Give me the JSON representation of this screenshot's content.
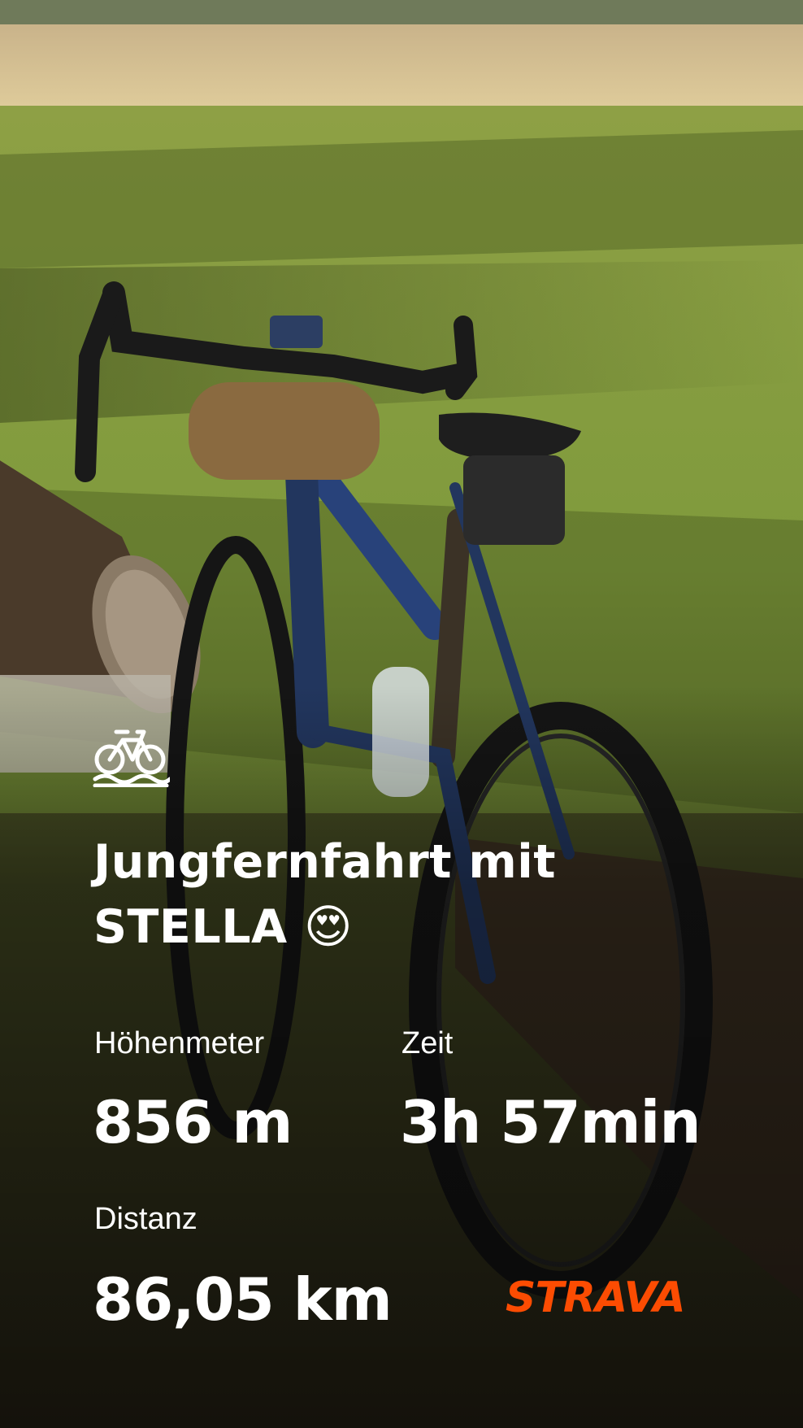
{
  "story": {
    "title": "Jungfernfahrt mit STELLA 😍",
    "activity_icon": "bike-icon",
    "stats": [
      {
        "label": "Höhenmeter",
        "value": "856 m"
      },
      {
        "label": "Zeit",
        "value": "3h 57min"
      },
      {
        "label": "Distanz",
        "value": "86,05 km"
      }
    ],
    "brand": "STRAVA"
  },
  "colors": {
    "brand": "#fc4c02",
    "text": "#ffffff"
  }
}
